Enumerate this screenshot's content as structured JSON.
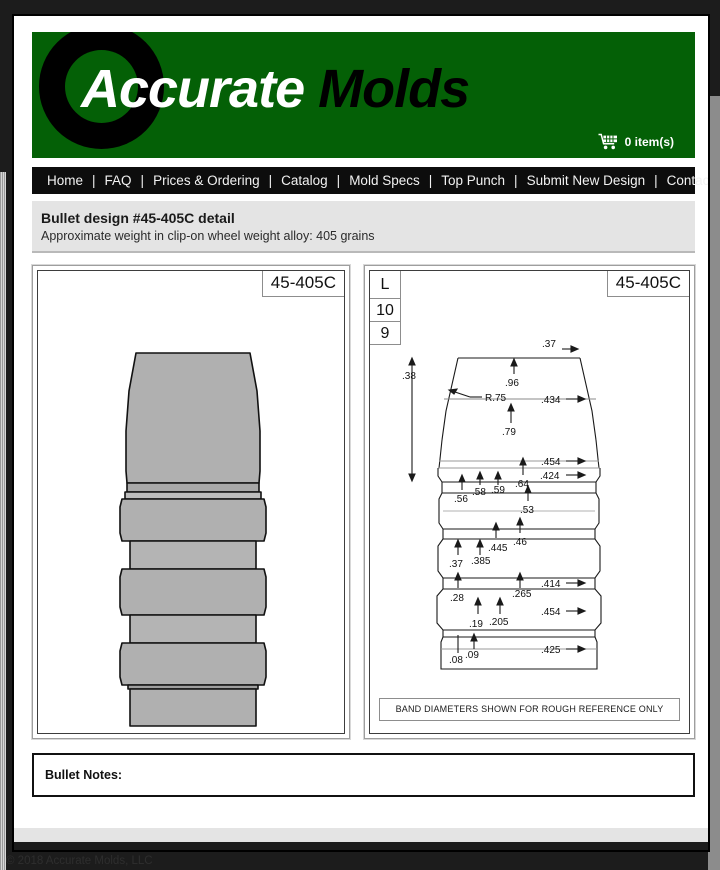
{
  "site": {
    "brand_word_1": "Accurate",
    "brand_word_2": "Molds",
    "logo_icon": "bullseye-target-icon",
    "brand_green": "#046006"
  },
  "cart": {
    "icon": "shopping-cart-icon",
    "label": "0 item(s)",
    "count": 0
  },
  "nav": {
    "items": [
      {
        "label": "Home"
      },
      {
        "label": "FAQ"
      },
      {
        "label": "Prices & Ordering"
      },
      {
        "label": "Catalog"
      },
      {
        "label": "Mold Specs"
      },
      {
        "label": "Top Punch"
      },
      {
        "label": "Submit New Design"
      },
      {
        "label": "Contact"
      }
    ],
    "separator": "|"
  },
  "page_header": {
    "title": "Bullet design #45-405C detail",
    "subtitle": "Approximate weight in clip-on wheel weight alloy: 405 grains"
  },
  "render_panel": {
    "design_tag": "45-405C"
  },
  "drawing_panel": {
    "design_tag": "45-405C",
    "cavity_letter": "L",
    "cell_top": "10",
    "cell_bottom": "9",
    "footnote": "BAND DIAMETERS SHOWN FOR ROUGH REFERENCE ONLY",
    "dimensions": {
      "nose_height": ".38",
      "nose_width": ".96",
      "meplat": ".37",
      "radius": "R.75",
      "ogive_len": ".79",
      "band1_dia": ".434",
      "drive_len": ".64",
      "band2_dia": ".454",
      "groove1_dia": ".424",
      "d_56": ".56",
      "d_58": ".58",
      "d_59": ".59",
      "d_53": ".53",
      "d_46": ".46",
      "d_445": ".445",
      "d_37": ".37",
      "d_385": ".385",
      "d_28": ".28",
      "d_265": ".265",
      "band3_dia": ".414",
      "d_19": ".19",
      "d_205": ".205",
      "band4_dia": ".454",
      "d_08": ".08",
      "d_09": ".09",
      "base_dia": ".425"
    }
  },
  "notes": {
    "label": "Bullet Notes:"
  },
  "footer": {
    "copyright": "© 2018 Accurate Molds, LLC"
  }
}
